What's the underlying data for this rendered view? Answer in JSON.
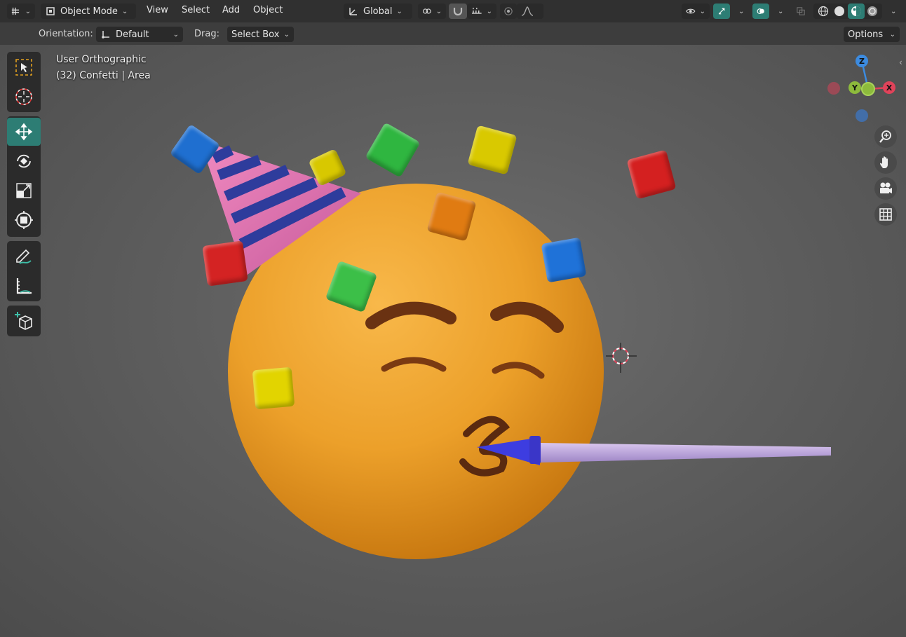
{
  "header": {
    "editor_icon": "editor-type-icon",
    "mode": "Object Mode",
    "menus": [
      "View",
      "Select",
      "Add",
      "Object"
    ],
    "transform_orientation": "Global",
    "options_label": "Options"
  },
  "toolsettings": {
    "orientation_label": "Orientation:",
    "orientation_value": "Default",
    "drag_label": "Drag:",
    "drag_value": "Select Box"
  },
  "viewport": {
    "view_name": "User Orthographic",
    "object_info": "(32) Confetti | Area"
  },
  "gizmo": {
    "x": "X",
    "y": "Y",
    "z": "Z"
  },
  "toolbar": {
    "tools": [
      "select-box-icon",
      "cursor-icon",
      "move-icon",
      "rotate-icon",
      "scale-icon",
      "transform-icon",
      "annotate-icon",
      "measure-icon",
      "add-cube-icon"
    ],
    "active_tool": "move-icon"
  },
  "navigation": [
    "zoom-icon",
    "pan-hand-icon",
    "camera-icon",
    "grid-icon"
  ],
  "colors": {
    "accent": "#2d7d74",
    "header_bg": "#303030",
    "axis_x": "#e0435a",
    "axis_y": "#8dbb3c",
    "axis_z": "#3c8be0"
  }
}
